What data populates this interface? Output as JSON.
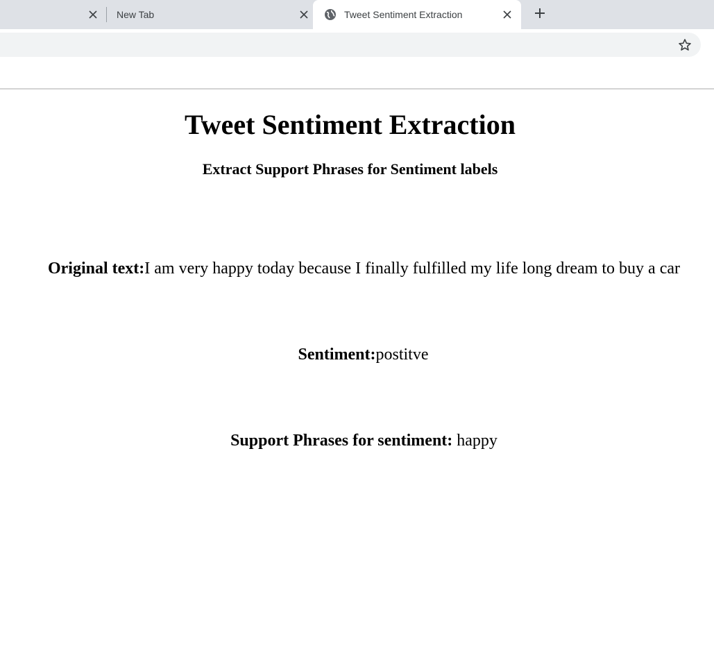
{
  "browser": {
    "tabs": [
      {
        "label": ""
      },
      {
        "label": "New Tab"
      },
      {
        "label": "Tweet Sentiment Extraction",
        "active": true
      }
    ],
    "icons": [
      "close-icon",
      "globe-icon",
      "plus-icon",
      "star-icon"
    ]
  },
  "page": {
    "title": "Tweet Sentiment Extraction",
    "subtitle": "Extract Support Phrases for Sentiment labels",
    "original_text": {
      "label": "Original text:",
      "value": "I am very happy today because I finally fulfilled my life long dream to buy a car"
    },
    "sentiment": {
      "label": "Sentiment:",
      "value": "postitve"
    },
    "support_phrases": {
      "label": "Support Phrases for sentiment:",
      "value": " happy"
    }
  }
}
